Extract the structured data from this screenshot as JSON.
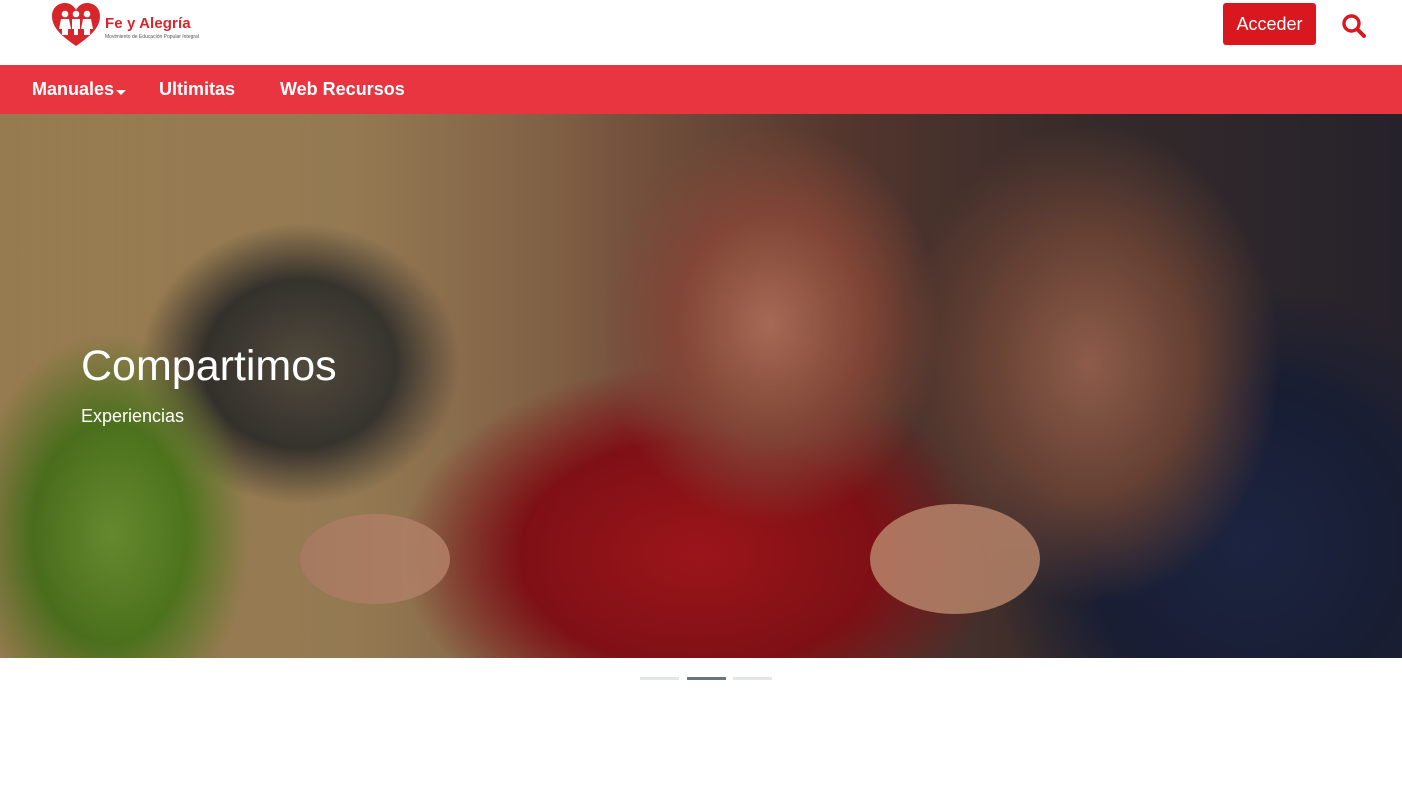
{
  "header": {
    "logo": {
      "brand": "Fe y Alegría",
      "tagline": "Movimiento de Educación Popular Integral",
      "heart_text": "FE Y ALEGRIA"
    },
    "login_label": "Acceder",
    "search_icon": "search-icon"
  },
  "nav": {
    "items": [
      {
        "label": "Manuales",
        "has_dropdown": true
      },
      {
        "label": "Ultimitas",
        "has_dropdown": false
      },
      {
        "label": "Web Recursos",
        "has_dropdown": false
      }
    ]
  },
  "carousel": {
    "slide": {
      "title": "Compartimos",
      "subtitle": "Experiencias"
    },
    "indicators": [
      {
        "active": false
      },
      {
        "active": true
      },
      {
        "active": false
      }
    ]
  },
  "colors": {
    "brand_red": "#d7262b",
    "nav_red": "#e83540",
    "button_red": "#d8171e",
    "indicator_active": "#6c757d",
    "indicator_inactive": "#e3e6e8"
  }
}
